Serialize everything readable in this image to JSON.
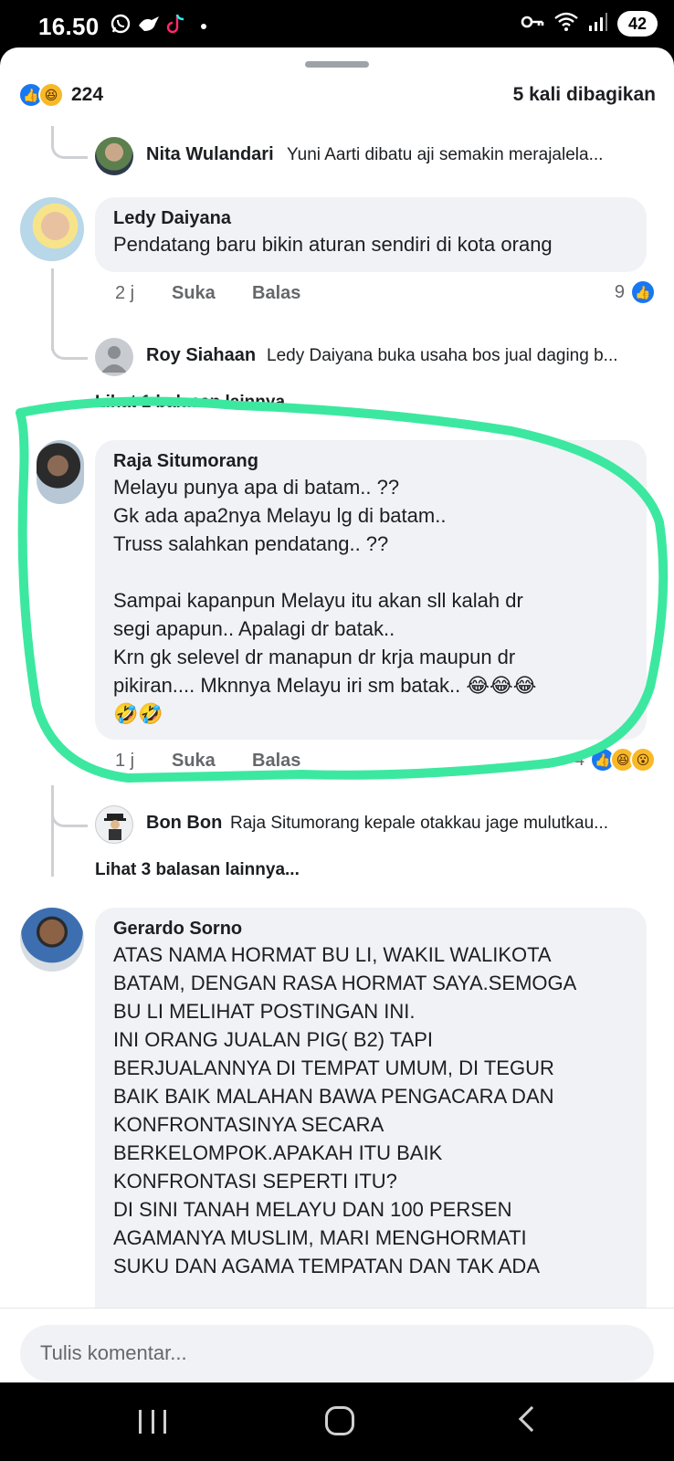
{
  "status_bar": {
    "time": "16.50",
    "battery": "42"
  },
  "reactions_summary": {
    "count": "224",
    "shares": "5 kali dibagikan"
  },
  "comments": [
    {
      "id": "nita",
      "type": "reply",
      "name": "Nita Wulandari",
      "text": "Yuni Aarti dibatu aji semakin merajalela..."
    },
    {
      "id": "ledy",
      "type": "comment",
      "name": "Ledy Daiyana",
      "text": "Pendatang baru bikin aturan sendiri di kota orang",
      "time": "2 j",
      "like_label": "Suka",
      "reply_label": "Balas",
      "reaction_count": "9"
    },
    {
      "id": "roy",
      "type": "reply",
      "name": "Roy Siahaan",
      "text": "Ledy Daiyana buka usaha bos jual daging b..."
    },
    {
      "id": "more1",
      "type": "more",
      "text": "Lihat 1 balasan lainnya..."
    },
    {
      "id": "raja",
      "type": "comment",
      "name": "Raja Situmorang",
      "text": "Melayu punya apa di batam.. ??\nGk ada apa2nya Melayu lg di batam..\nTruss salahkan pendatang.. ??\n\nSampai kapanpun Melayu itu akan sll kalah dr\nsegi apapun.. Apalagi dr batak..\nKrn gk selevel dr manapun dr krja maupun dr\npikiran.... Mknnya Melayu iri sm batak.. 😂😂😂\n🤣🤣",
      "time": "1 j",
      "like_label": "Suka",
      "reply_label": "Balas",
      "reaction_count": "4"
    },
    {
      "id": "bon",
      "type": "reply",
      "name": "Bon Bon",
      "text": "Raja Situmorang kepale otakkau jage mulutkau..."
    },
    {
      "id": "more3",
      "type": "more",
      "text": "Lihat 3 balasan lainnya..."
    },
    {
      "id": "gerardo",
      "type": "comment",
      "name": "Gerardo Sorno",
      "text": "ATAS NAMA HORMAT BU LI, WAKIL WALIKOTA\nBATAM, DENGAN RASA HORMAT SAYA.SEMOGA\nBU LI MELIHAT POSTINGAN INI.\nINI ORANG JUALAN PIG( B2) TAPI\nBERJUALANNYA DI TEMPAT UMUM, DI TEGUR\nBAIK BAIK MALAHAN BAWA PENGACARA DAN\nKONFRONTASINYA SECARA\nBERKELOMPOK.APAKAH ITU BAIK\nKONFRONTASI SEPERTI ITU?\nDI SINI TANAH MELAYU DAN 100 PERSEN\nAGAMANYA MUSLIM, MARI MENGHORMATI\nSUKU DAN AGAMA TEMPATAN DAN TAK ADA"
    }
  ],
  "compose": {
    "placeholder": "Tulis komentar..."
  },
  "colors": {
    "like_blue": "#1877f2",
    "highlight_green": "#3ce8a0",
    "bubble_bg": "#f0f2f5"
  },
  "icons": [
    "whatsapp-icon",
    "bird-icon",
    "tiktok-icon",
    "key-icon",
    "wifi-icon",
    "signal-icon",
    "like-icon",
    "haha-icon",
    "wow-icon",
    "recent-apps-icon",
    "home-icon",
    "back-icon"
  ]
}
